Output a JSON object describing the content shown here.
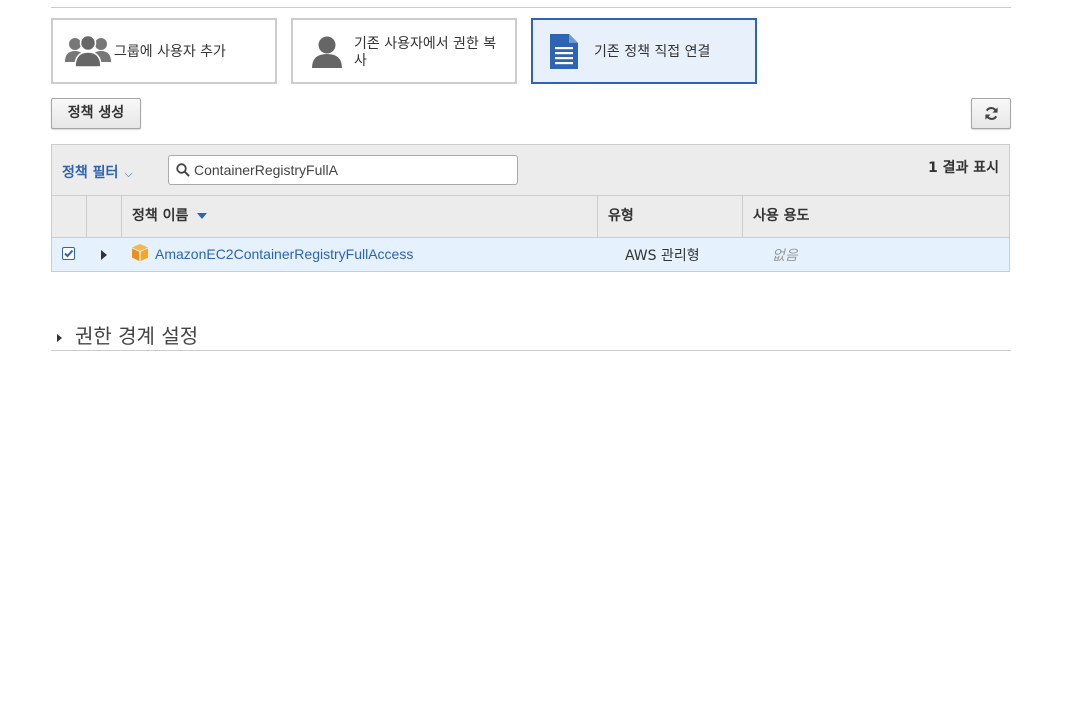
{
  "options": [
    {
      "label": "그룹에 사용자 추가",
      "icon": "users-group-icon",
      "selected": false
    },
    {
      "label": "기존 사용자에서 권한 복사",
      "icon": "user-icon",
      "selected": false
    },
    {
      "label": "기존 정책 직접 연결",
      "icon": "document-icon",
      "selected": true
    }
  ],
  "buttons": {
    "create_policy": "정책 생성",
    "refresh_icon": "refresh-icon"
  },
  "filter": {
    "label": "정책 필터",
    "chevron": "⌵",
    "search_value": "ContainerRegistryFullA",
    "result_count": "1 결과 표시"
  },
  "table": {
    "headers": {
      "name": "정책 이름",
      "type": "유형",
      "usage": "사용 용도"
    },
    "rows": [
      {
        "checked": true,
        "name": "AmazonEC2ContainerRegistryFullAccess",
        "type": "AWS 관리형",
        "usage": "없음"
      }
    ]
  },
  "boundary": {
    "title": "권한 경계 설정"
  },
  "colors": {
    "accent": "#2d64b3",
    "selected_bg": "#e8f1fb",
    "row_selected_bg": "#e5f1fd",
    "policy_icon": "#f5a623"
  }
}
